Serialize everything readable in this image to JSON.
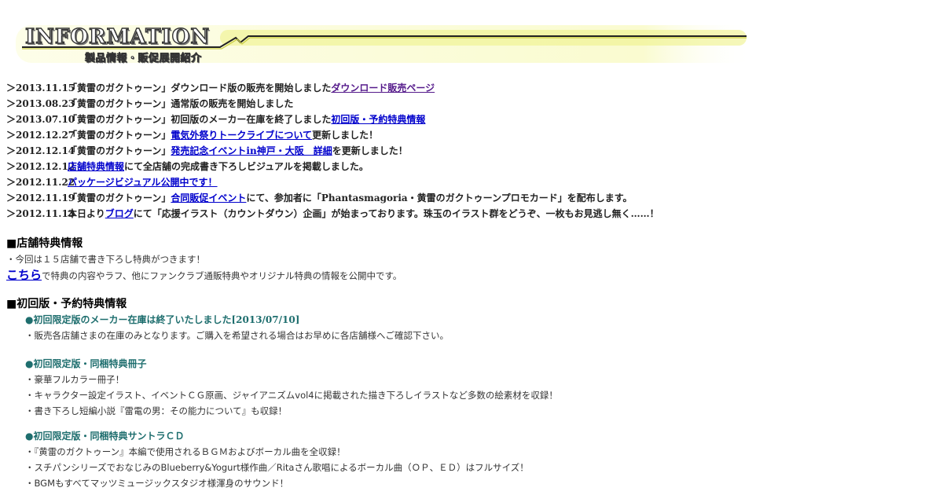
{
  "banner": {
    "title": "INFORMATION",
    "subtitle": "製品情報・販促展開紹介"
  },
  "news": [
    {
      "date": "＞2013.11.15",
      "before": "「黄雷のガクトゥーン」ダウンロード版の販売を開始しました",
      "link": "ダウンロード販売ページ",
      "after": ""
    },
    {
      "date": "＞2013.08.23",
      "before": "「黄雷のガクトゥーン」通常版の販売を開始しました",
      "link": "",
      "after": ""
    },
    {
      "date": "＞2013.07.10",
      "before": "「黄雷のガクトゥーン」初回版のメーカー在庫を終了しました",
      "link": "初回版・予約特典情報",
      "after": ""
    },
    {
      "date": "＞2012.12.27",
      "before": "「黄雷のガクトゥーン」",
      "link": "電気外祭りトークライブについて",
      "after": "更新しました！"
    },
    {
      "date": "＞2012.12.14",
      "before": "「黄雷のガクトゥーン」",
      "link": "発売記念イベントin神戸・大阪　詳細",
      "after": "を更新しました！"
    },
    {
      "date": "＞2012.12.12",
      "before": "",
      "link": "店舗特典情報",
      "after": "にて全店舗の完成書き下ろしビジュアルを掲載しました。"
    },
    {
      "date": "＞2012.11.22",
      "before": "",
      "link": "パッケージビジュアル公開中です！",
      "after": ""
    },
    {
      "date": "＞2012.11.19",
      "before": "「黄雷のガクトゥーン」",
      "link": "合同販促イベント",
      "after": "にて、参加者に「Phantasmagoria・黄雷のガクトゥーンプロモカード」を配布します。"
    },
    {
      "date": "＞2012.11.13",
      "before": "本日より",
      "link": "ブログ",
      "after": "にて「応援イラスト（カウントダウン）企画」が始まっております。珠玉のイラスト群をどうぞ、一枚もお見逃し無く……！"
    }
  ],
  "store_section": {
    "title": "■店舗特典情報",
    "line1": "・今回は１５店舗で書き下ろし特典がつきます！",
    "link": "こちら",
    "line2": "で特典の内容やラフ、他にファンクラブ通販特典やオリジナル特典の情報を公開中です。"
  },
  "first_section": {
    "title": "■初回版・予約特典情報",
    "notice_head": "●初回限定版のメーカー在庫は終了いたしました[2013/07/10]",
    "notice_text": "・販売各店舗さまの在庫のみとなります。ご購入を希望される場合はお早めに各店舗様へご確認下さい。",
    "booklet_head": "●初回限定版・同梱特典冊子",
    "booklet_items": [
      "・豪華フルカラー冊子！",
      "・キャラクター設定イラスト、イベントＣＧ原画、ジャイアニズムvol4に掲載された描き下ろしイラストなど多数の絵素材を収録！",
      "・書き下ろし短編小説『雷電の男：その能力について』も収録！"
    ],
    "cd_head": "●初回限定版・同梱特典サントラＣＤ",
    "cd_items": [
      "・『黄雷のガクトゥーン』本編で使用されるＢＧＭおよびボーカル曲を全収録！",
      "・スチパンシリーズでおなじみのBlueberry&Yogurt様作曲／Ritaさん歌唱によるボーカル曲（ＯＰ、ＥＤ）はフルサイズ！",
      "・BGMもすべてマッツミュージックスタジオ様渾身のサウンド！"
    ]
  },
  "colors": {
    "link": "#0000cc",
    "visited_link": "#551a8b",
    "green_heading": "#1e6e6e",
    "banner_glow": "#f4f7a0"
  }
}
